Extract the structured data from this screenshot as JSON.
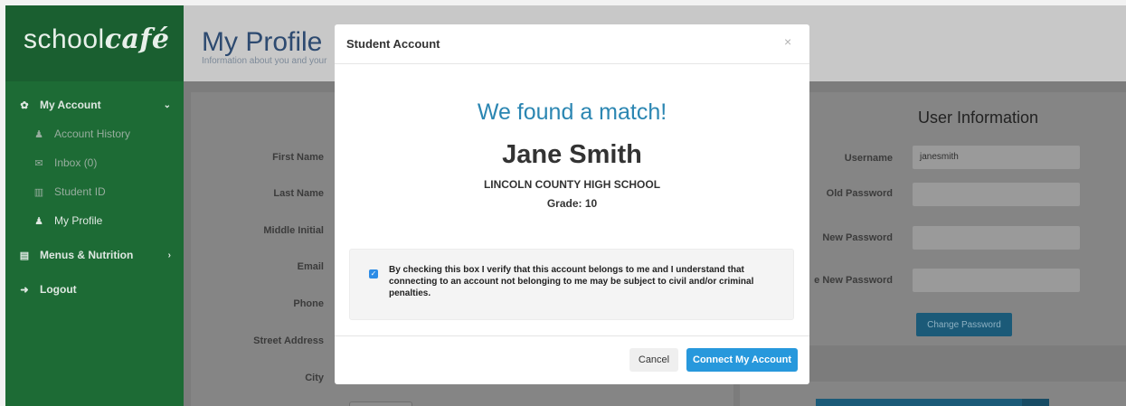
{
  "brand": {
    "logo_plain": "school",
    "logo_script": "café"
  },
  "sidebar": {
    "items": [
      {
        "label": "My Account",
        "icon": "gear-icon"
      },
      {
        "label": "Account History",
        "icon": "user-icon"
      },
      {
        "label": "Inbox (0)",
        "icon": "envelope-icon"
      },
      {
        "label": "Student ID",
        "icon": "barcode-icon"
      },
      {
        "label": "My Profile",
        "icon": "user-icon"
      },
      {
        "label": "Menus & Nutrition",
        "icon": "menu-icon"
      },
      {
        "label": "Logout",
        "icon": "logout-icon"
      }
    ]
  },
  "header": {
    "title": "My Profile",
    "subtitle": "Information about you and your"
  },
  "profile_form": {
    "labels": [
      "First Name",
      "Last Name",
      "Middle Initial",
      "Email",
      "Phone",
      "Street Address",
      "City"
    ]
  },
  "user_info": {
    "title": "User Information",
    "username_label": "Username",
    "username_value": "janesmith",
    "old_password_label": "Old Password",
    "new_password_label": "New Password",
    "confirm_password_label": "e New Password",
    "change_button": "Change Password"
  },
  "modal": {
    "title": "Student Account",
    "close": "×",
    "match_text": "We found a match!",
    "student_name": "Jane Smith",
    "school": "LINCOLN COUNTY HIGH SCHOOL",
    "grade": "Grade: 10",
    "verify_text": "By checking this box I verify that this account belongs to me and I understand that connecting to an account not belonging to me may be subject to civil and/or criminal penalties.",
    "verify_checked": true,
    "cancel_label": "Cancel",
    "connect_label": "Connect My Account"
  },
  "colors": {
    "sidebar": "#1d6b35",
    "accent": "#2798dc",
    "match_text": "#2b86b2"
  }
}
